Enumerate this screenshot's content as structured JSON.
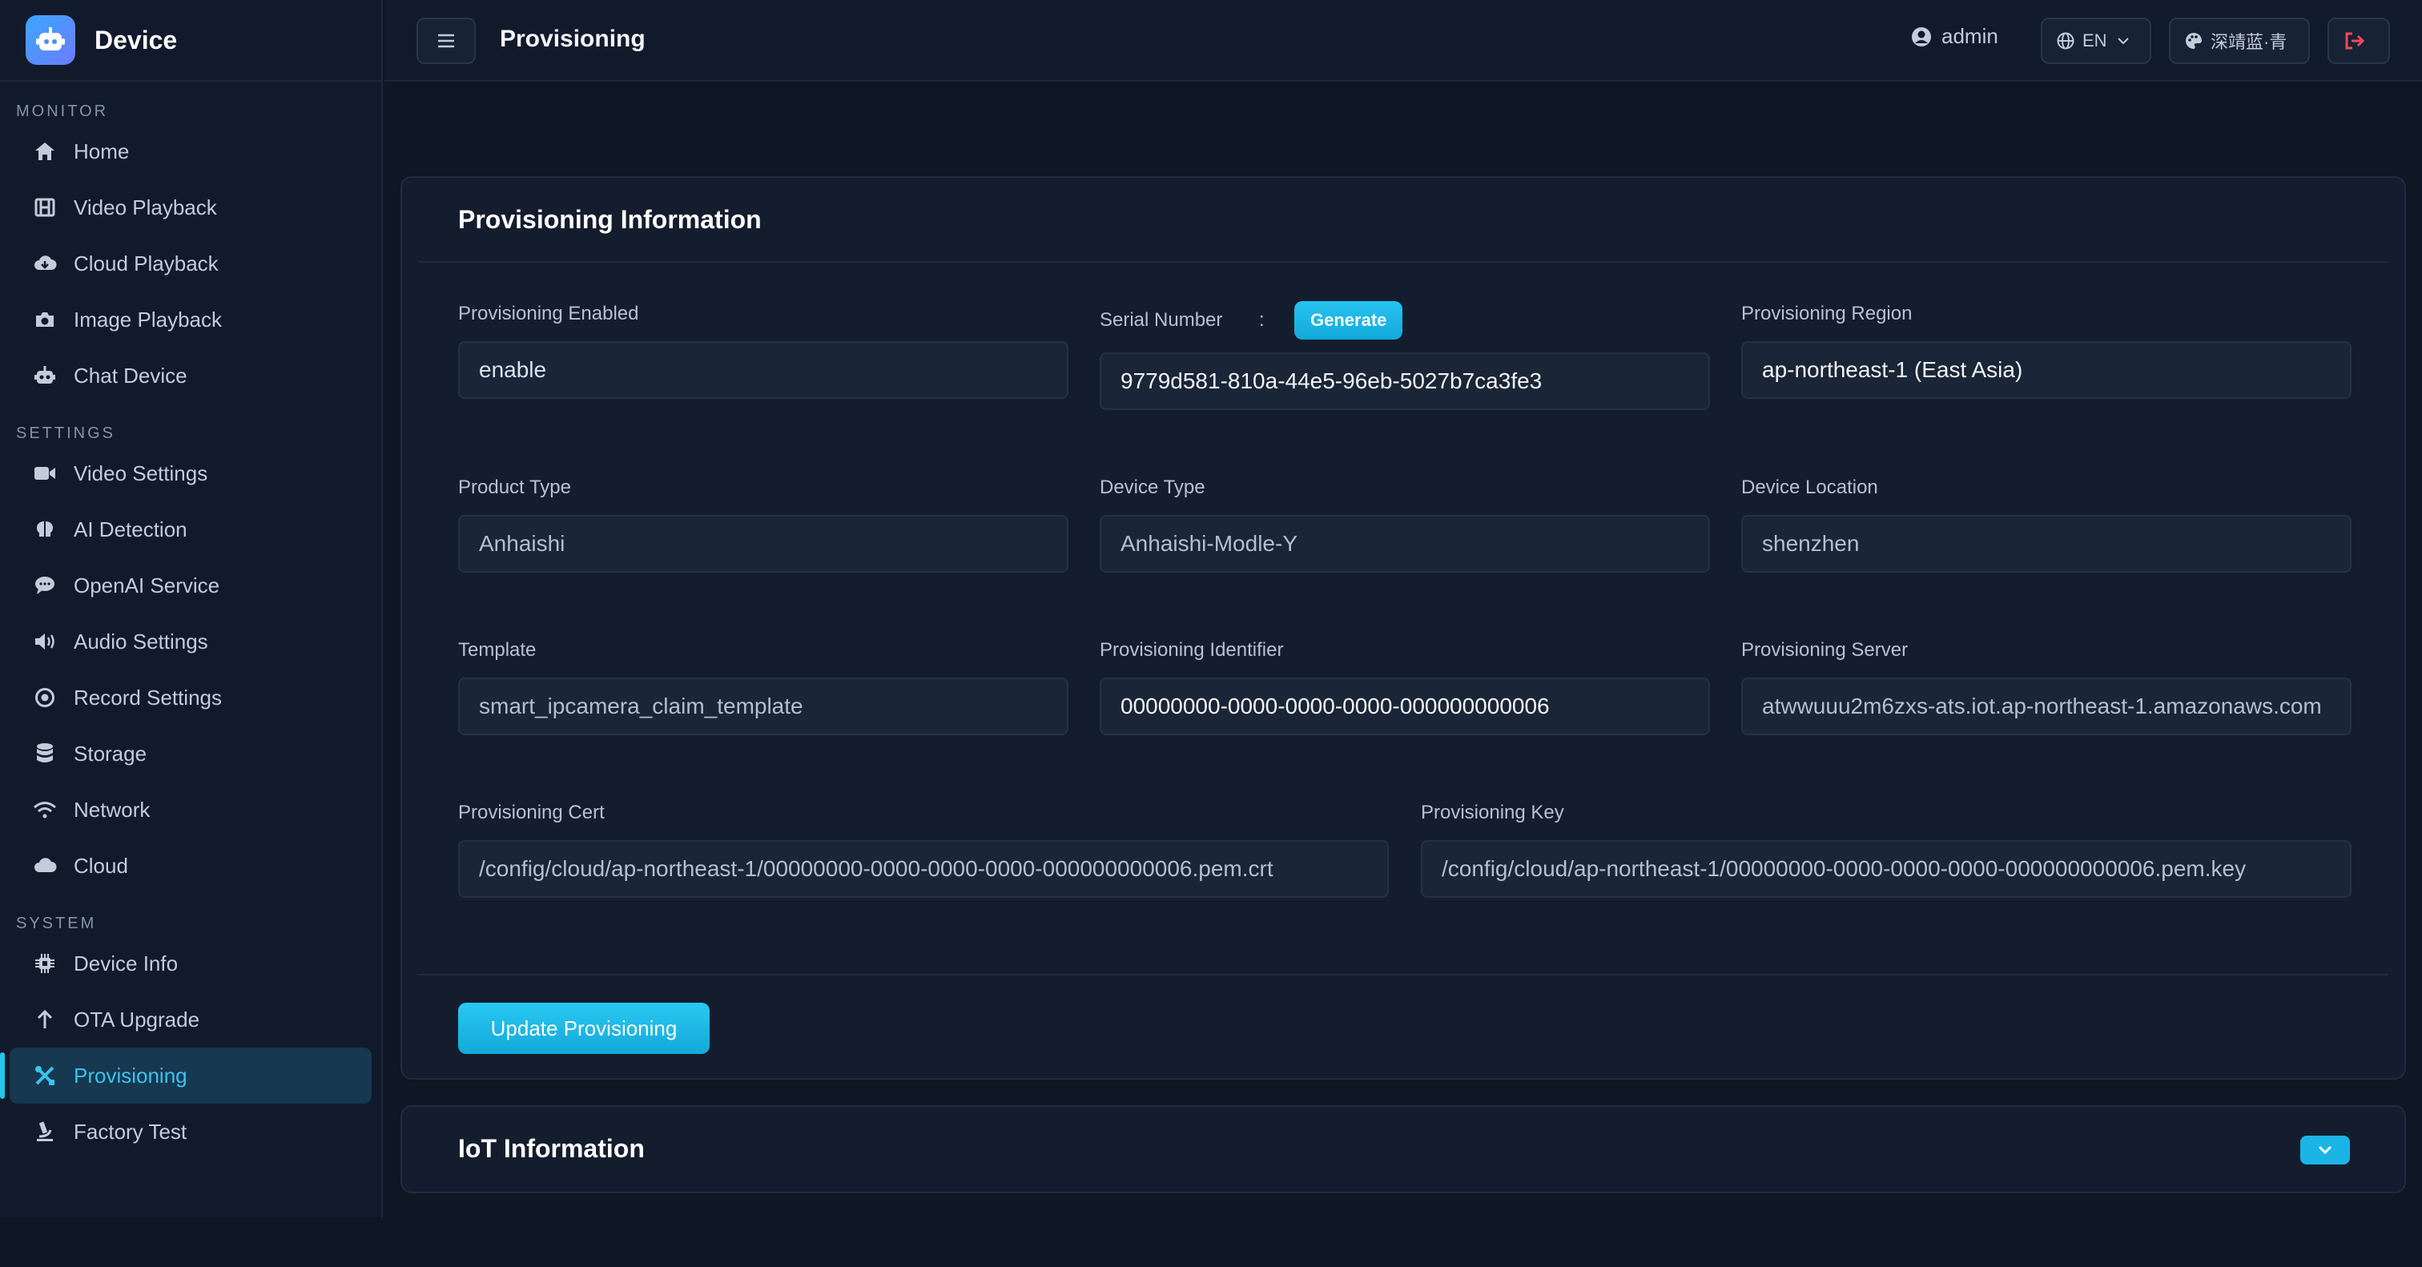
{
  "brand": {
    "title": "Device"
  },
  "sidebar": {
    "sections": [
      {
        "title": "MONITOR",
        "items": [
          {
            "label": "Home",
            "icon": "home-icon"
          },
          {
            "label": "Video Playback",
            "icon": "film-icon"
          },
          {
            "label": "Cloud Playback",
            "icon": "cloud-download-icon"
          },
          {
            "label": "Image Playback",
            "icon": "camera-icon"
          },
          {
            "label": "Chat Device",
            "icon": "robot-icon"
          }
        ]
      },
      {
        "title": "SETTINGS",
        "items": [
          {
            "label": "Video Settings",
            "icon": "video-camera-icon"
          },
          {
            "label": "AI Detection",
            "icon": "brain-icon"
          },
          {
            "label": "OpenAI Service",
            "icon": "chat-icon"
          },
          {
            "label": "Audio Settings",
            "icon": "speaker-icon"
          },
          {
            "label": "Record Settings",
            "icon": "record-icon"
          },
          {
            "label": "Storage",
            "icon": "database-icon"
          },
          {
            "label": "Network",
            "icon": "wifi-icon"
          },
          {
            "label": "Cloud",
            "icon": "cloud-icon"
          }
        ]
      },
      {
        "title": "SYSTEM",
        "items": [
          {
            "label": "Device Info",
            "icon": "chip-icon"
          },
          {
            "label": "OTA Upgrade",
            "icon": "arrow-up-icon"
          },
          {
            "label": "Provisioning",
            "icon": "tools-icon",
            "active": true
          },
          {
            "label": "Factory Test",
            "icon": "microscope-icon"
          }
        ]
      }
    ]
  },
  "header": {
    "title": "Provisioning",
    "user": "admin",
    "language": "EN",
    "theme": "深靖蓝·青"
  },
  "provisioning": {
    "title": "Provisioning Information",
    "enabled": {
      "label": "Provisioning Enabled",
      "value": "enable"
    },
    "serial": {
      "label": "Serial Number",
      "separator": ":",
      "button": "Generate",
      "value": "9779d581-810a-44e5-96eb-5027b7ca3fe3"
    },
    "region": {
      "label": "Provisioning Region",
      "value": "ap-northeast-1 (East Asia)"
    },
    "product_type": {
      "label": "Product Type",
      "value": "Anhaishi"
    },
    "device_type": {
      "label": "Device Type",
      "value": "Anhaishi-Modle-Y"
    },
    "device_location": {
      "label": "Device Location",
      "value": "shenzhen"
    },
    "template": {
      "label": "Template",
      "value": "smart_ipcamera_claim_template"
    },
    "identifier": {
      "label": "Provisioning Identifier",
      "value": "00000000-0000-0000-0000-000000000006"
    },
    "server": {
      "label": "Provisioning Server",
      "value": "atwwuuu2m6zxs-ats.iot.ap-northeast-1.amazonaws.com"
    },
    "cert": {
      "label": "Provisioning Cert",
      "value": "/config/cloud/ap-northeast-1/00000000-0000-0000-0000-000000000006.pem.crt"
    },
    "key": {
      "label": "Provisioning Key",
      "value": "/config/cloud/ap-northeast-1/00000000-0000-0000-0000-000000000006.pem.key"
    },
    "update_button": "Update Provisioning"
  },
  "iot": {
    "title": "IoT Information"
  },
  "colors": {
    "accent": "#22c6f0",
    "background": "#0f1624",
    "card": "#131d2e"
  }
}
